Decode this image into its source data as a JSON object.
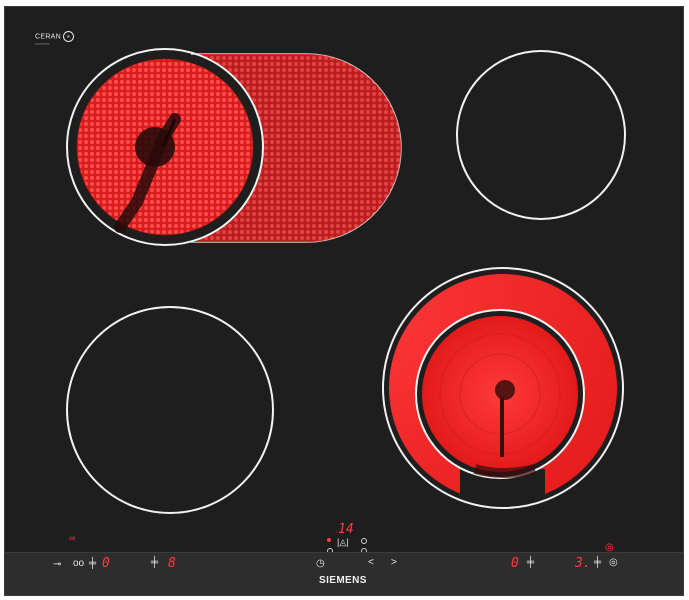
{
  "brand": {
    "name": "SIEMENS",
    "glass_logo": "CERAN",
    "glass_logo_mark": "®"
  },
  "zones": [
    {
      "id": "rear-left",
      "type": "dual-extended",
      "state": "on"
    },
    {
      "id": "rear-right",
      "type": "single",
      "state": "off"
    },
    {
      "id": "front-left",
      "type": "single",
      "state": "off"
    },
    {
      "id": "front-right",
      "type": "dual-ring",
      "state": "on"
    }
  ],
  "controls": {
    "timer_display": "14",
    "left_zone_level": "0",
    "left_zone2_level": "8",
    "right_zone_level": "0",
    "right_zone2_level": "3.",
    "left_pair_icon": "oo",
    "arrow_left": "<",
    "arrow_right": ">"
  },
  "colors": {
    "glass": "#1e1e1e",
    "heat": "#ff2a2a",
    "ring": "#f2f2f2",
    "display": "#ff3b3b"
  }
}
